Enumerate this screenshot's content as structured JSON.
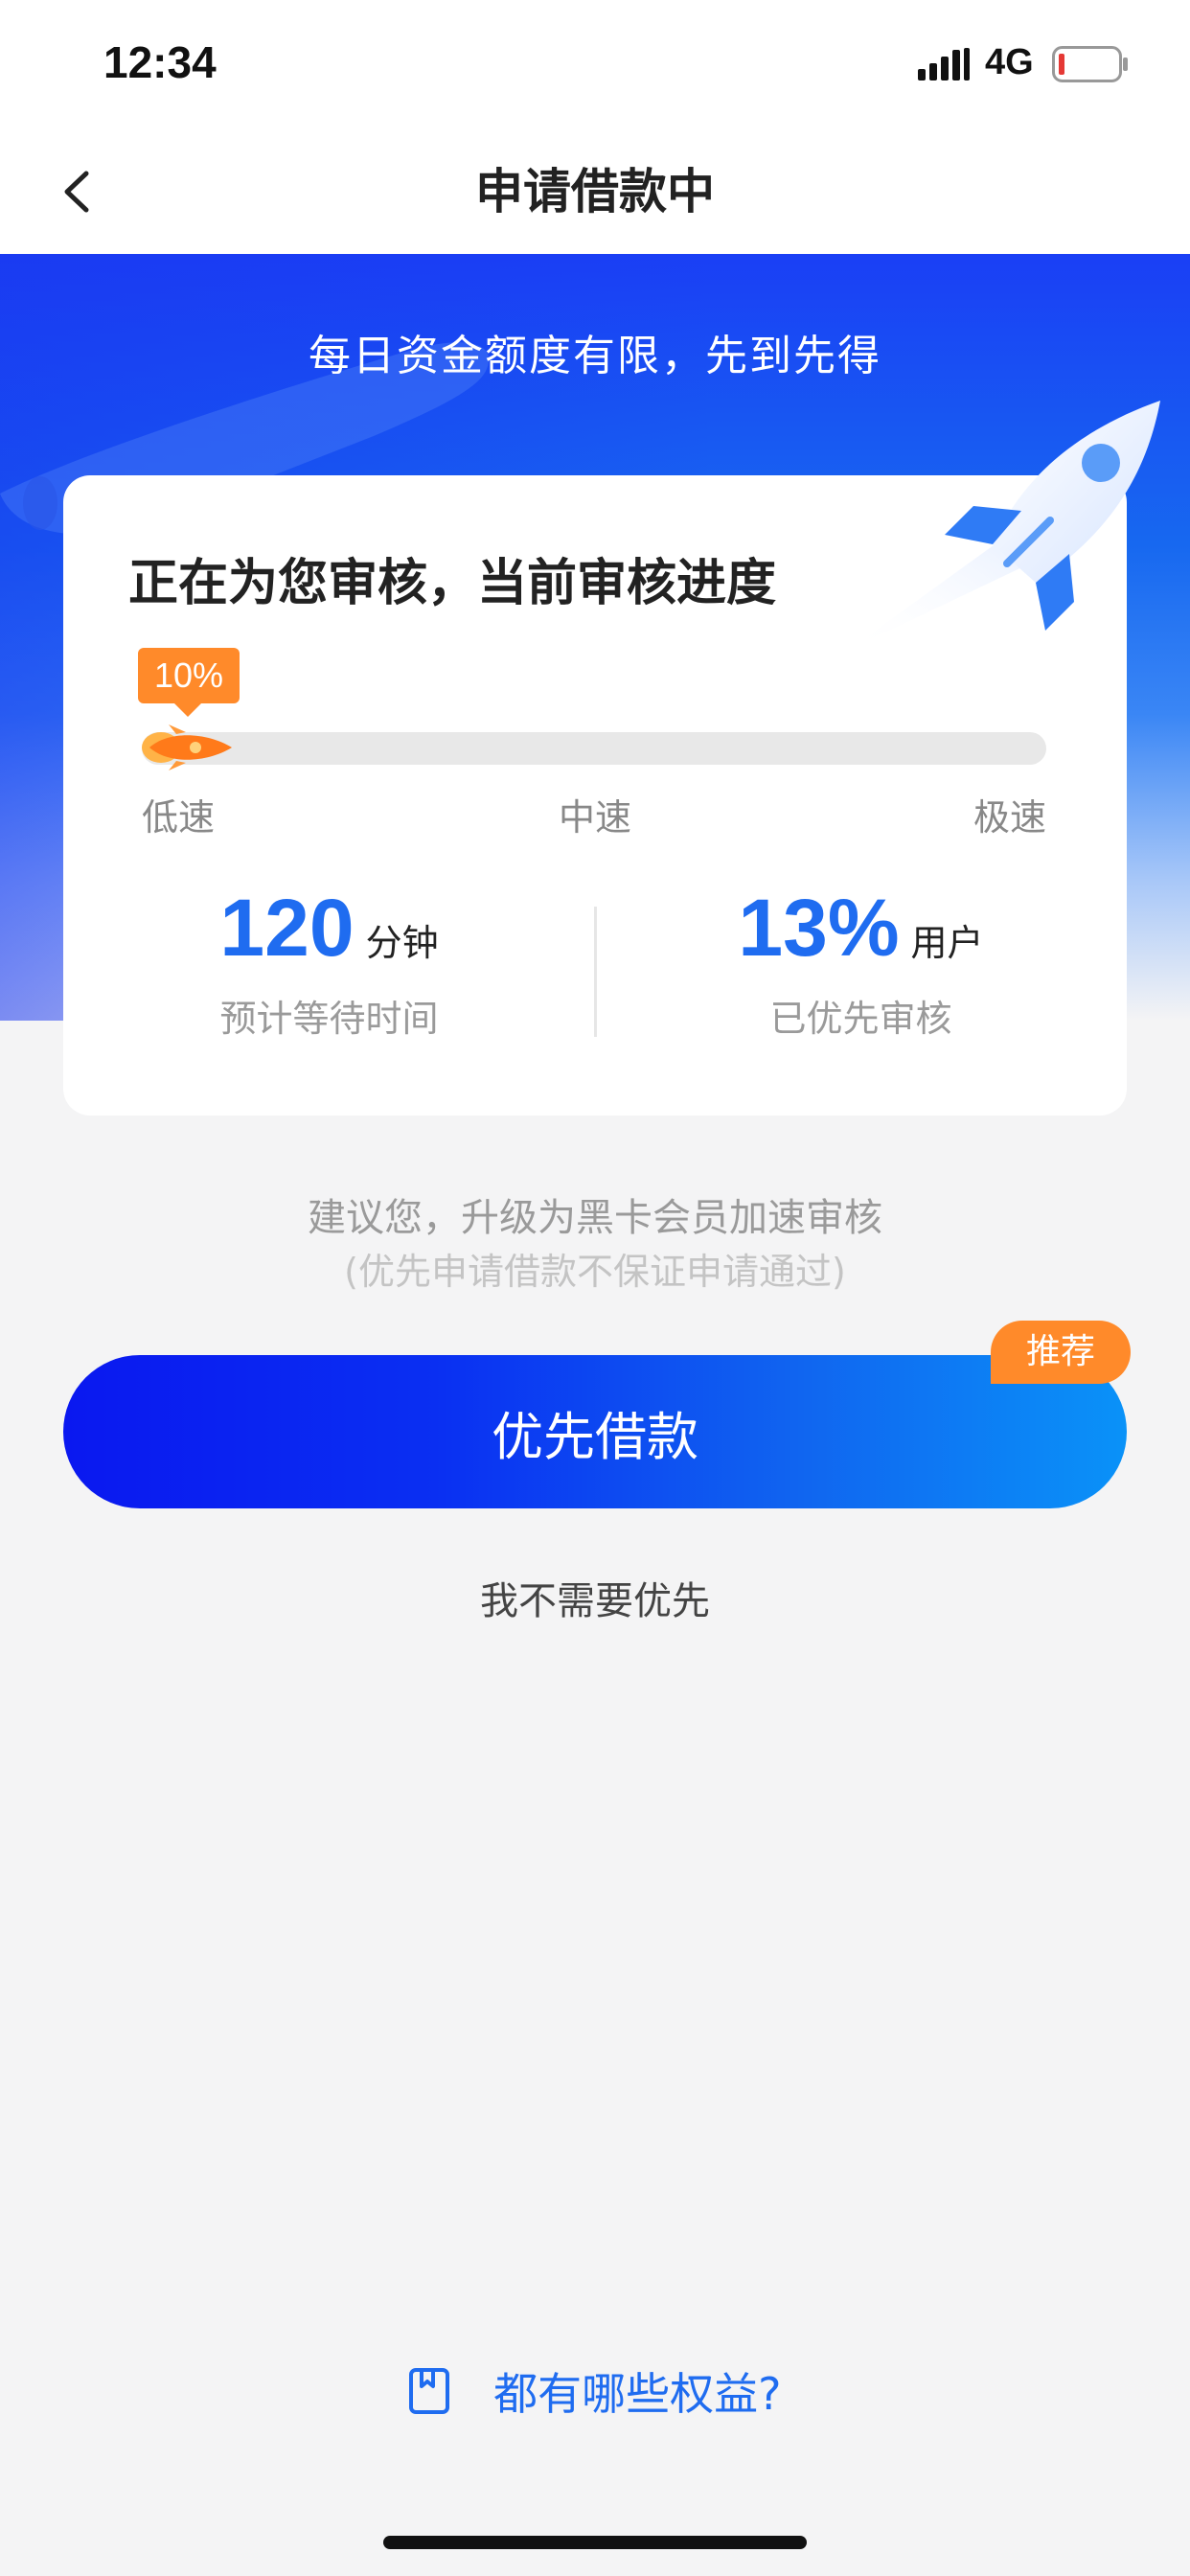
{
  "status_bar": {
    "time": "12:34",
    "network": "4G",
    "icons": [
      "signal-icon",
      "battery-icon"
    ]
  },
  "nav": {
    "title": "申请借款中",
    "back_icon": "chevron-left-icon"
  },
  "hero": {
    "slogan": "每日资金额度有限，先到先得"
  },
  "card": {
    "title": "正在为您审核，当前审核进度",
    "progress": {
      "badge": "10%",
      "value": 0.1,
      "speed_labels": [
        "低速",
        "中速",
        "极速"
      ]
    },
    "stats": [
      {
        "value": "120",
        "unit": "分钟",
        "caption": "预计等待时间"
      },
      {
        "value": "13%",
        "unit": "用户",
        "caption": "已优先审核"
      }
    ]
  },
  "suggestion": {
    "line1": "建议您，升级为黑卡会员加速审核",
    "line2": "(优先申请借款不保证申请通过)"
  },
  "actions": {
    "priority_button": "优先借款",
    "recommend_tag": "推荐",
    "skip": "我不需要优先"
  },
  "benefits": {
    "label": "都有哪些权益?",
    "icon": "bookmark-icon"
  },
  "colors": {
    "brand_blue": "#1f6cf0",
    "accent_orange": "#ff8a2a"
  }
}
